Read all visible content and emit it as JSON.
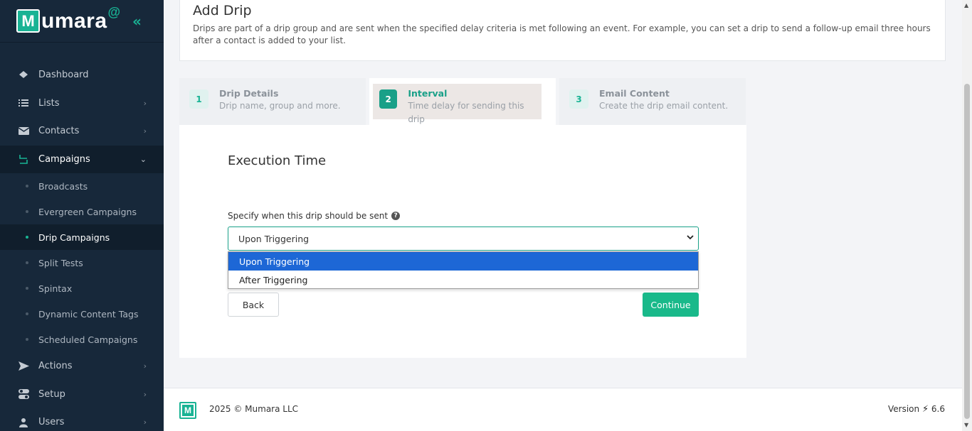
{
  "brand": {
    "logo_letter": "M",
    "name": "umara",
    "at": "@",
    "collapse_icon": "double-chevron-left-icon"
  },
  "sidebar": {
    "items": [
      {
        "label": "Dashboard",
        "icon": "diamond-icon"
      },
      {
        "label": "Lists",
        "icon": "list-icon"
      },
      {
        "label": "Contacts",
        "icon": "envelope-icon"
      },
      {
        "label": "Campaigns",
        "icon": "arrows-icon"
      },
      {
        "label": "Actions",
        "icon": "paper-plane-icon"
      },
      {
        "label": "Setup",
        "icon": "toggle-icon"
      },
      {
        "label": "Users",
        "icon": "user-icon"
      }
    ],
    "campaigns_sub": [
      "Broadcasts",
      "Evergreen Campaigns",
      "Drip Campaigns",
      "Split Tests",
      "Spintax",
      "Dynamic Content Tags",
      "Scheduled Campaigns"
    ]
  },
  "header": {
    "title": "Add Drip",
    "description": "Drips are part of a drip group and are sent when the specified delay criteria is met following an event. For example, you can set a drip to send a follow-up email three hours after a contact is added to your list."
  },
  "steps": [
    {
      "num": "1",
      "title": "Drip Details",
      "desc": "Drip name, group and more."
    },
    {
      "num": "2",
      "title": "Interval",
      "desc": "Time delay for sending this drip"
    },
    {
      "num": "3",
      "title": "Email Content",
      "desc": "Create the drip email content."
    }
  ],
  "form": {
    "section_title": "Execution Time",
    "field_label": "Specify when this drip should be sent",
    "help": "?",
    "selected_value": "Upon Triggering",
    "options": [
      "Upon Triggering",
      "After Triggering"
    ],
    "back_label": "Back",
    "continue_label": "Continue"
  },
  "footer": {
    "logo_letter": "M",
    "copyright": "2025 © Mumara LLC",
    "version_label": "Version",
    "version_number": "6.6"
  },
  "colors": {
    "accent": "#19b394",
    "sidebar_bg": "#17283a",
    "option_highlight": "#1d67d6",
    "continue_bg": "#19b98a"
  }
}
